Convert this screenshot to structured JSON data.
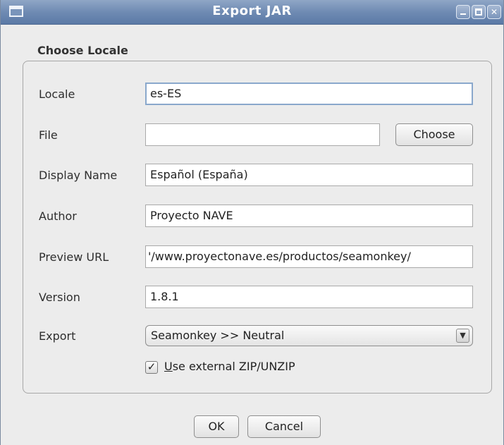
{
  "window": {
    "title": "Export JAR",
    "controls": {
      "minimize_icon": "minimize-icon",
      "maximize_icon": "maximize-icon",
      "close_icon": "close-icon"
    }
  },
  "group": {
    "title": "Choose Locale"
  },
  "form": {
    "locale": {
      "label": "Locale",
      "value": "es-ES"
    },
    "file": {
      "label": "File",
      "value": "",
      "button": "Choose"
    },
    "display_name": {
      "label": "Display Name",
      "value": "Español (España)"
    },
    "author": {
      "label": "Author",
      "value": "Proyecto NAVE"
    },
    "preview_url": {
      "label": "Preview URL",
      "value": "'/www.proyectonave.es/productos/seamonkey/"
    },
    "version": {
      "label": "Version",
      "value": "1.8.1"
    },
    "export": {
      "label": "Export",
      "selected": "Seamonkey >> Neutral",
      "arrow_icon": "dropdown-arrow-icon"
    },
    "use_external_zip": {
      "checked": true,
      "label_mnemonic": "U",
      "label_rest": "se external ZIP/UNZIP"
    }
  },
  "buttons": {
    "ok": "OK",
    "cancel": "Cancel"
  },
  "colors": {
    "titlebar": "#6f8bb3",
    "focus_border": "#8aa8cc",
    "background": "#ececec"
  }
}
